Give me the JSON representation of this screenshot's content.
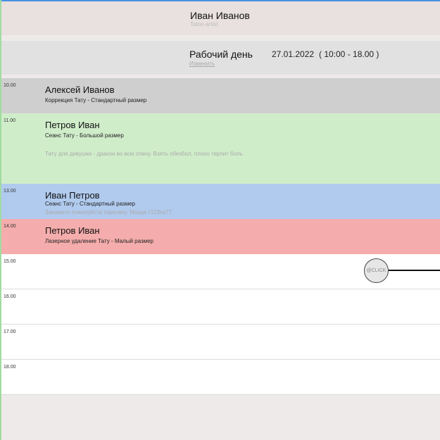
{
  "header": {
    "master_name": "Иван Иванов",
    "master_role": "Tatoo-artist"
  },
  "workday": {
    "label": "Рабочий день",
    "change_link": "Изменить",
    "date": "27.01.2022",
    "hours": "( 10:00 - 18.00 )"
  },
  "appointments": [
    {
      "time": "10.00",
      "client": "Алексей Иванов",
      "service": "Коррекция Тату - Стандартный размер",
      "note": ""
    },
    {
      "time": "11.00",
      "client": "Петров Иван",
      "service": "Сеанс Тату - Большой размер",
      "note": "Тату для девушки - дракон во всю спину. Взять обезбол, плохо терпит боль."
    },
    {
      "time": "13.00",
      "client": "Иван Петров",
      "service": "Сеанс Тату - Стандартный размер",
      "note": "Закажите пожалуйста парковку. Мазда т123ка77"
    },
    {
      "time": "14.00",
      "client": "Петров Иван",
      "service": "Лазерное удаление Тату - Малый размер",
      "note": ""
    }
  ],
  "empty_slots": [
    "15.00",
    "16.00",
    "17.00",
    "18.00"
  ],
  "click_button_label": "@CLICK",
  "colors": {
    "slot_10": "#cfcfcf",
    "slot_11": "#d0edca",
    "slot_13": "#b1cbee",
    "slot_14": "#f4adac"
  }
}
